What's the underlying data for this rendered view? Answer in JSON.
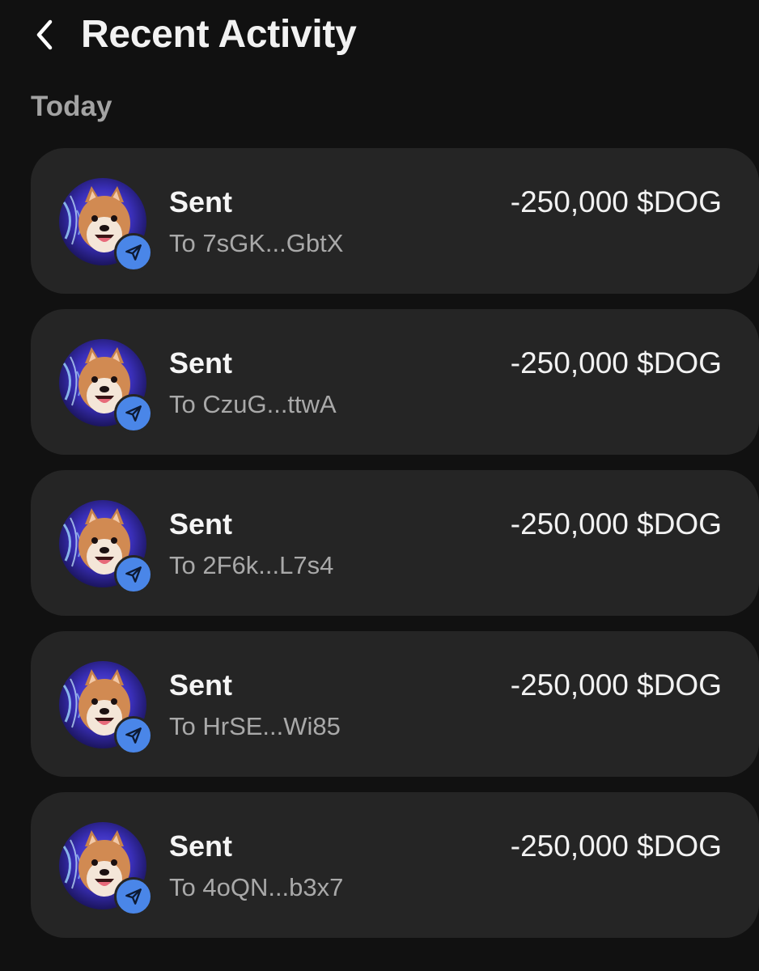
{
  "header": {
    "title": "Recent Activity"
  },
  "section": {
    "label": "Today"
  },
  "transactions": [
    {
      "type": "Sent",
      "destination": "To 7sGK...GbtX",
      "amount": "-250,000 $DOG"
    },
    {
      "type": "Sent",
      "destination": "To CzuG...ttwA",
      "amount": "-250,000 $DOG"
    },
    {
      "type": "Sent",
      "destination": "To 2F6k...L7s4",
      "amount": "-250,000 $DOG"
    },
    {
      "type": "Sent",
      "destination": "To HrSE...Wi85",
      "amount": "-250,000 $DOG"
    },
    {
      "type": "Sent",
      "destination": "To 4oQN...b3x7",
      "amount": "-250,000 $DOG"
    }
  ],
  "icons": {
    "back": "chevron-left-icon",
    "avatar": "shiba-dog-token-avatar",
    "badge": "send-arrow-icon"
  },
  "colors": {
    "background": "#111111",
    "card": "#252525",
    "badge": "#4a86e8",
    "secondary_text": "#a9a9a9"
  }
}
